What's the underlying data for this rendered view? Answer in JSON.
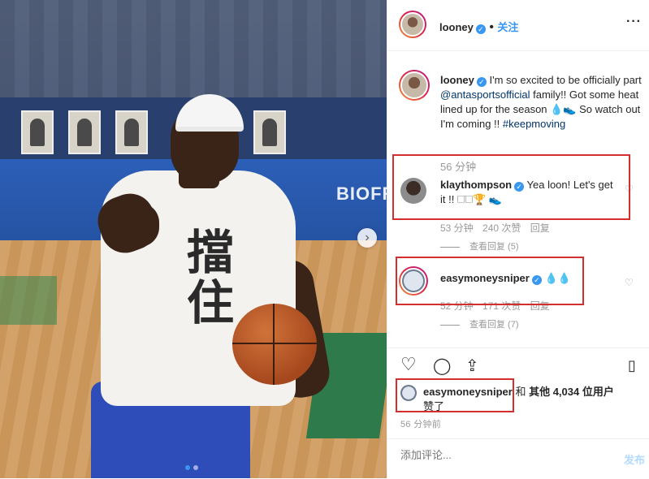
{
  "colors": {
    "accent": "#3897f0",
    "highlight_box": "#d32f2f",
    "muted": "#999999",
    "text": "#262626"
  },
  "photo": {
    "brand_text": "BIOFR",
    "shirt_text": "擋住",
    "carousel_next_icon": "chevron-right-icon",
    "carousel": {
      "total": 2,
      "active": 1
    }
  },
  "header": {
    "username": "looney",
    "follow_label": "关注",
    "more_icon": "ellipsis-icon"
  },
  "caption": {
    "username": "looney",
    "text_before": " I'm so excited to be officially part ",
    "mention": "@antasportsofficial",
    "text_after": " family!! Got some heat lined up for the season 💧👟 So watch out I'm coming !! ",
    "hashtag": "#keepmoving",
    "time": "56 分钟"
  },
  "comments": [
    {
      "username": "klaythompson",
      "text": "Yea loon! Let's get it !! 🗆🗆🏆 👟",
      "time": "53 分钟",
      "likes": "240 次赞",
      "reply_label": "回复",
      "view_replies": "查看回复 (5)"
    },
    {
      "username": "easymoneysniper",
      "text": "💧💧",
      "time": "52 分钟",
      "likes": "171 次赞",
      "reply_label": "回复",
      "view_replies": "查看回复 (7)"
    }
  ],
  "likes": {
    "username": "easymoneysniper",
    "and": " 和 ",
    "others": "其他 4,034 位用户",
    "suffix": "赞了"
  },
  "post_time": "56 分钟前",
  "add_comment": {
    "placeholder": "添加评论...",
    "post_label": "发布"
  }
}
